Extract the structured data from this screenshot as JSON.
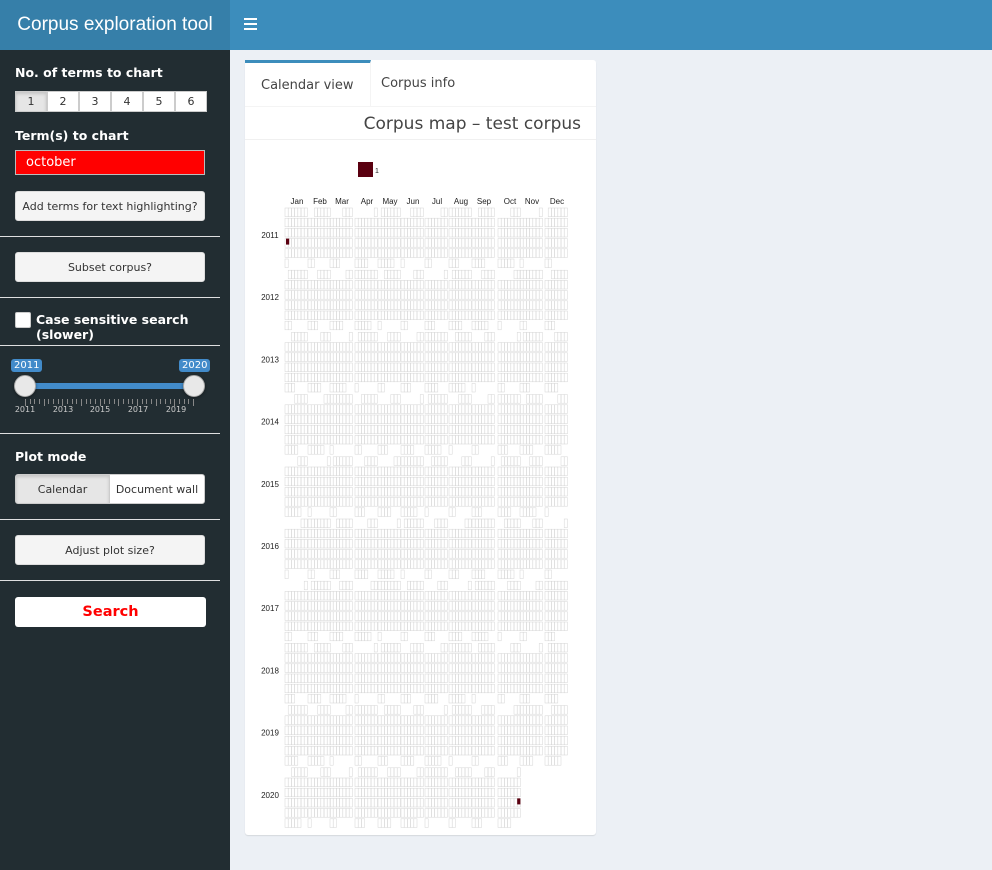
{
  "header": {
    "title": "Corpus exploration tool"
  },
  "sidebar": {
    "num_terms_label": "No. of terms to chart",
    "num_terms_options": [
      "1",
      "2",
      "3",
      "4",
      "5",
      "6"
    ],
    "terms_label": "Term(s) to chart",
    "term_value": "october",
    "highlight_button": "Add terms for text highlighting?",
    "subset_button": "Subset corpus?",
    "case_label": "Case sensitive search (slower)",
    "slider": {
      "min_label": "2011",
      "max_label": "2020",
      "ticks": [
        "2011",
        "2013",
        "2015",
        "2017",
        "2019"
      ]
    },
    "plot_mode_label": "Plot mode",
    "plot_modes": [
      "Calendar",
      "Document wall"
    ],
    "adjust_button": "Adjust plot size?",
    "search_button": "Search"
  },
  "main": {
    "tabs": [
      "Calendar view",
      "Corpus info"
    ],
    "title": "Corpus map – test corpus"
  },
  "chart_data": {
    "type": "heatmap",
    "legend_value": "1",
    "legend_color": "#5a0010",
    "months": [
      "Jan",
      "Feb",
      "Mar",
      "Apr",
      "May",
      "Jun",
      "Jul",
      "Aug",
      "Sep",
      "Oct",
      "Nov",
      "Dec"
    ],
    "years": [
      "2011",
      "2012",
      "2013",
      "2014",
      "2015",
      "2016",
      "2017",
      "2018",
      "2019",
      "2020"
    ],
    "hits": [
      {
        "year": "2011",
        "month": "Jan",
        "count": 1
      },
      {
        "year": "2020",
        "month": "Oct",
        "count": 1
      }
    ]
  }
}
